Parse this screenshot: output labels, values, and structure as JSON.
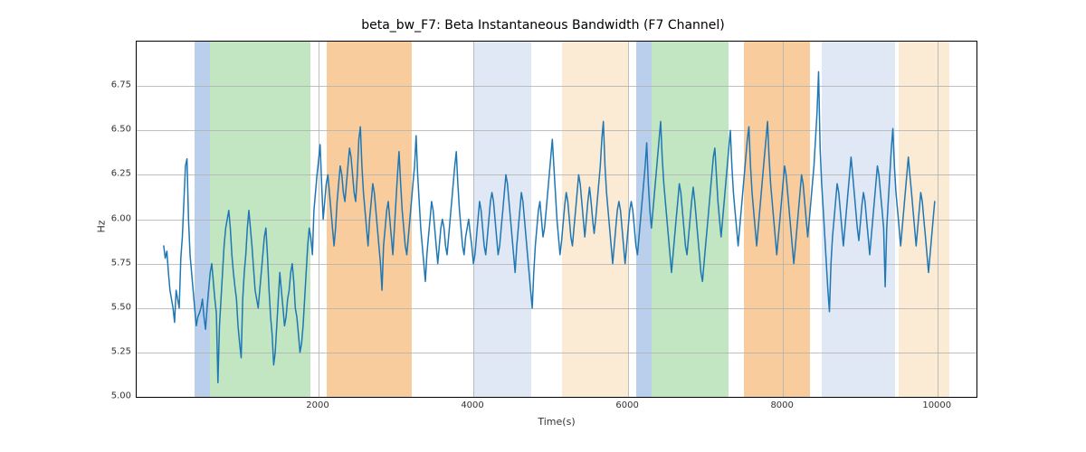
{
  "chart_data": {
    "type": "line",
    "title": "beta_bw_F7: Beta Instantaneous Bandwidth (F7 Channel)",
    "xlabel": "Time(s)",
    "ylabel": "Hz",
    "xlim": [
      -350,
      10500
    ],
    "ylim": [
      5.0,
      7.0
    ],
    "xticks": [
      2000,
      4000,
      6000,
      8000,
      10000
    ],
    "yticks": [
      5.0,
      5.25,
      5.5,
      5.75,
      6.0,
      6.25,
      6.5,
      6.75
    ],
    "ytick_labels": [
      "5.00",
      "5.25",
      "5.50",
      "5.75",
      "6.00",
      "6.25",
      "6.50",
      "6.75"
    ],
    "bands": [
      {
        "x0": 400,
        "x1": 600,
        "color": "#aec7e8",
        "alpha": 0.85
      },
      {
        "x0": 600,
        "x1": 1900,
        "color": "#b6e2b6",
        "alpha": 0.85
      },
      {
        "x0": 2100,
        "x1": 3200,
        "color": "#f7c38b",
        "alpha": 0.85
      },
      {
        "x0": 4000,
        "x1": 4750,
        "color": "#c9d9ec",
        "alpha": 0.6
      },
      {
        "x0": 5150,
        "x1": 6000,
        "color": "#f8dcb8",
        "alpha": 0.6
      },
      {
        "x0": 6100,
        "x1": 6300,
        "color": "#aec7e8",
        "alpha": 0.85
      },
      {
        "x0": 6300,
        "x1": 7300,
        "color": "#b6e2b6",
        "alpha": 0.85
      },
      {
        "x0": 7500,
        "x1": 8350,
        "color": "#f7c38b",
        "alpha": 0.85
      },
      {
        "x0": 8500,
        "x1": 9450,
        "color": "#c9d9ec",
        "alpha": 0.6
      },
      {
        "x0": 9500,
        "x1": 10150,
        "color": "#f8dcb8",
        "alpha": 0.6
      }
    ],
    "series": [
      {
        "name": "beta_bw_F7",
        "color": "#1f77b4",
        "x_start": 0,
        "x_step": 20,
        "y": [
          5.85,
          5.78,
          5.82,
          5.7,
          5.6,
          5.55,
          5.5,
          5.42,
          5.6,
          5.55,
          5.5,
          5.78,
          5.9,
          6.1,
          6.3,
          6.34,
          6.0,
          5.8,
          5.7,
          5.6,
          5.5,
          5.4,
          5.45,
          5.47,
          5.5,
          5.55,
          5.45,
          5.38,
          5.5,
          5.6,
          5.7,
          5.75,
          5.65,
          5.55,
          5.47,
          5.08,
          5.4,
          5.55,
          5.7,
          5.85,
          5.95,
          6.0,
          6.05,
          5.95,
          5.8,
          5.7,
          5.62,
          5.55,
          5.4,
          5.3,
          5.22,
          5.55,
          5.7,
          5.8,
          5.95,
          6.05,
          5.95,
          5.85,
          5.72,
          5.6,
          5.55,
          5.5,
          5.6,
          5.7,
          5.8,
          5.9,
          5.95,
          5.8,
          5.6,
          5.45,
          5.35,
          5.18,
          5.25,
          5.4,
          5.55,
          5.7,
          5.6,
          5.5,
          5.4,
          5.45,
          5.55,
          5.6,
          5.7,
          5.75,
          5.65,
          5.5,
          5.45,
          5.35,
          5.25,
          5.3,
          5.4,
          5.55,
          5.7,
          5.85,
          5.95,
          5.9,
          5.8,
          6.05,
          6.15,
          6.25,
          6.33,
          6.42,
          6.2,
          6.0,
          6.1,
          6.2,
          6.25,
          6.15,
          6.05,
          5.95,
          5.85,
          5.95,
          6.1,
          6.2,
          6.3,
          6.25,
          6.15,
          6.1,
          6.2,
          6.3,
          6.4,
          6.35,
          6.25,
          6.15,
          6.1,
          6.25,
          6.45,
          6.52,
          6.3,
          6.15,
          6.05,
          5.95,
          5.85,
          6.0,
          6.1,
          6.2,
          6.15,
          6.05,
          5.95,
          5.85,
          5.75,
          5.6,
          5.85,
          5.95,
          6.05,
          6.1,
          6.0,
          5.9,
          5.8,
          5.95,
          6.1,
          6.25,
          6.38,
          6.2,
          6.05,
          5.95,
          5.85,
          5.8,
          5.9,
          6.0,
          6.1,
          6.2,
          6.3,
          6.47,
          6.25,
          6.1,
          5.95,
          5.85,
          5.75,
          5.65,
          5.8,
          5.9,
          6.0,
          6.1,
          6.05,
          5.95,
          5.85,
          5.75,
          5.85,
          5.95,
          6.0,
          5.95,
          5.85,
          5.8,
          5.9,
          6.0,
          6.1,
          6.2,
          6.3,
          6.38,
          6.2,
          6.05,
          5.95,
          5.85,
          5.8,
          5.9,
          5.95,
          6.0,
          5.92,
          5.85,
          5.75,
          5.8,
          5.9,
          6.0,
          6.1,
          6.05,
          5.95,
          5.85,
          5.8,
          5.9,
          6.0,
          6.1,
          6.15,
          6.1,
          6.0,
          5.9,
          5.8,
          5.85,
          5.95,
          6.05,
          6.15,
          6.25,
          6.2,
          6.1,
          6.0,
          5.9,
          5.8,
          5.7,
          5.85,
          5.95,
          6.05,
          6.15,
          6.1,
          6.0,
          5.9,
          5.8,
          5.7,
          5.6,
          5.5,
          5.7,
          5.85,
          5.95,
          6.05,
          6.1,
          6.0,
          5.9,
          5.95,
          6.05,
          6.15,
          6.25,
          6.35,
          6.45,
          6.3,
          6.15,
          6.0,
          5.9,
          5.8,
          5.88,
          5.98,
          6.08,
          6.15,
          6.1,
          6.0,
          5.9,
          5.85,
          5.95,
          6.05,
          6.15,
          6.25,
          6.2,
          6.1,
          6.0,
          5.9,
          6.0,
          6.1,
          6.18,
          6.1,
          6.0,
          5.92,
          6.0,
          6.1,
          6.2,
          6.3,
          6.45,
          6.55,
          6.3,
          6.15,
          6.05,
          5.95,
          5.85,
          5.75,
          5.85,
          5.95,
          6.05,
          6.1,
          6.05,
          5.95,
          5.85,
          5.75,
          5.85,
          5.95,
          6.05,
          6.1,
          6.05,
          5.95,
          5.85,
          5.8,
          5.9,
          6.0,
          6.1,
          6.2,
          6.3,
          6.43,
          6.2,
          6.05,
          5.95,
          6.05,
          6.15,
          6.25,
          6.35,
          6.45,
          6.55,
          6.35,
          6.2,
          6.1,
          6.0,
          5.9,
          5.8,
          5.7,
          5.8,
          5.9,
          6.0,
          6.1,
          6.2,
          6.15,
          6.05,
          5.95,
          5.85,
          5.8,
          5.9,
          6.0,
          6.1,
          6.18,
          6.1,
          6.0,
          5.9,
          5.8,
          5.7,
          5.65,
          5.75,
          5.85,
          5.95,
          6.05,
          6.15,
          6.25,
          6.35,
          6.4,
          6.25,
          6.1,
          6.0,
          5.9,
          6.0,
          6.1,
          6.2,
          6.3,
          6.4,
          6.5,
          6.3,
          6.15,
          6.05,
          5.95,
          5.85,
          5.95,
          6.05,
          6.15,
          6.25,
          6.35,
          6.45,
          6.52,
          6.3,
          6.15,
          6.05,
          5.95,
          5.85,
          5.95,
          6.05,
          6.15,
          6.25,
          6.35,
          6.45,
          6.55,
          6.35,
          6.2,
          6.1,
          6.0,
          5.9,
          5.8,
          5.9,
          6.0,
          6.1,
          6.2,
          6.3,
          6.25,
          6.15,
          6.05,
          5.95,
          5.85,
          5.75,
          5.85,
          5.95,
          6.05,
          6.15,
          6.25,
          6.2,
          6.1,
          6.0,
          5.9,
          6.0,
          6.1,
          6.2,
          6.3,
          6.45,
          6.6,
          6.83,
          6.4,
          6.2,
          6.05,
          5.9,
          5.75,
          5.6,
          5.48,
          5.75,
          5.9,
          6.0,
          6.1,
          6.2,
          6.15,
          6.05,
          5.95,
          5.85,
          5.95,
          6.05,
          6.15,
          6.25,
          6.35,
          6.25,
          6.15,
          6.05,
          5.95,
          5.88,
          5.98,
          6.08,
          6.15,
          6.1,
          6.0,
          5.9,
          5.8,
          5.9,
          6.0,
          6.1,
          6.2,
          6.3,
          6.25,
          6.15,
          6.05,
          5.95,
          5.62,
          5.95,
          6.1,
          6.25,
          6.4,
          6.51,
          6.3,
          6.15,
          6.05,
          5.95,
          5.85,
          5.95,
          6.05,
          6.15,
          6.25,
          6.35,
          6.25,
          6.15,
          6.05,
          5.95,
          5.85,
          5.95,
          6.05,
          6.15,
          6.1,
          6.0,
          5.9,
          5.8,
          5.7,
          5.8,
          5.9,
          6.0,
          6.1
        ]
      }
    ]
  }
}
